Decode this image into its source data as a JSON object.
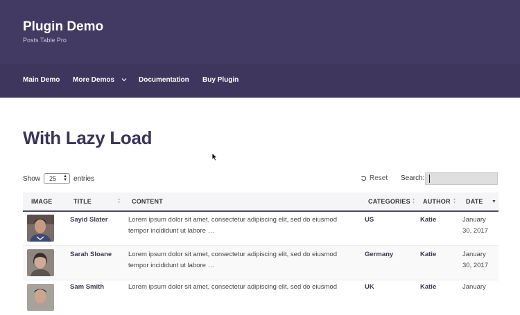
{
  "header": {
    "site_title": "Plugin Demo",
    "tagline": "Posts Table Pro",
    "nav": [
      "Main Demo",
      "More Demos",
      "Documentation",
      "Buy Plugin"
    ]
  },
  "page": {
    "title": "With Lazy Load"
  },
  "controls": {
    "show_label": "Show",
    "entries_value": "25",
    "entries_label": "entries",
    "reset_label": "Reset",
    "search_label": "Search:"
  },
  "table": {
    "columns": [
      "IMAGE",
      "TITLE",
      "CONTENT",
      "CATEGORIES",
      "AUTHOR",
      "DATE"
    ],
    "rows": [
      {
        "title": "Sayid Slater",
        "content_line1": "Lorem ipsum dolor sit amet, consectetur adipiscing elit, sed do eiusmod",
        "content_line2": "tempor incididunt ut labore …",
        "category": "US",
        "author": "Katie",
        "date_line1": "January",
        "date_line2": "30, 2017"
      },
      {
        "title": "Sarah Sloane",
        "content_line1": "Lorem ipsum dolor sit amet, consectetur adipiscing elit, sed do eiusmod",
        "content_line2": "tempor incididunt ut labore …",
        "category": "Germany",
        "author": "Katie",
        "date_line1": "January",
        "date_line2": "30, 2017"
      },
      {
        "title": "Sam Smith",
        "content_line1": "Lorem ipsum dolor sit amet, consectetur adipiscing elit, sed do eiusmod",
        "content_line2": "",
        "category": "UK",
        "author": "Katie",
        "date_line1": "January",
        "date_line2": ""
      }
    ]
  },
  "colors": {
    "header_bg": "#423a62",
    "nav_bg": "#3e365c",
    "title": "#3a3558"
  },
  "icons": {
    "nav_dropdown": "chevron-down-icon",
    "reset": "reset-icon",
    "cursor": "mouse-pointer-icon"
  }
}
